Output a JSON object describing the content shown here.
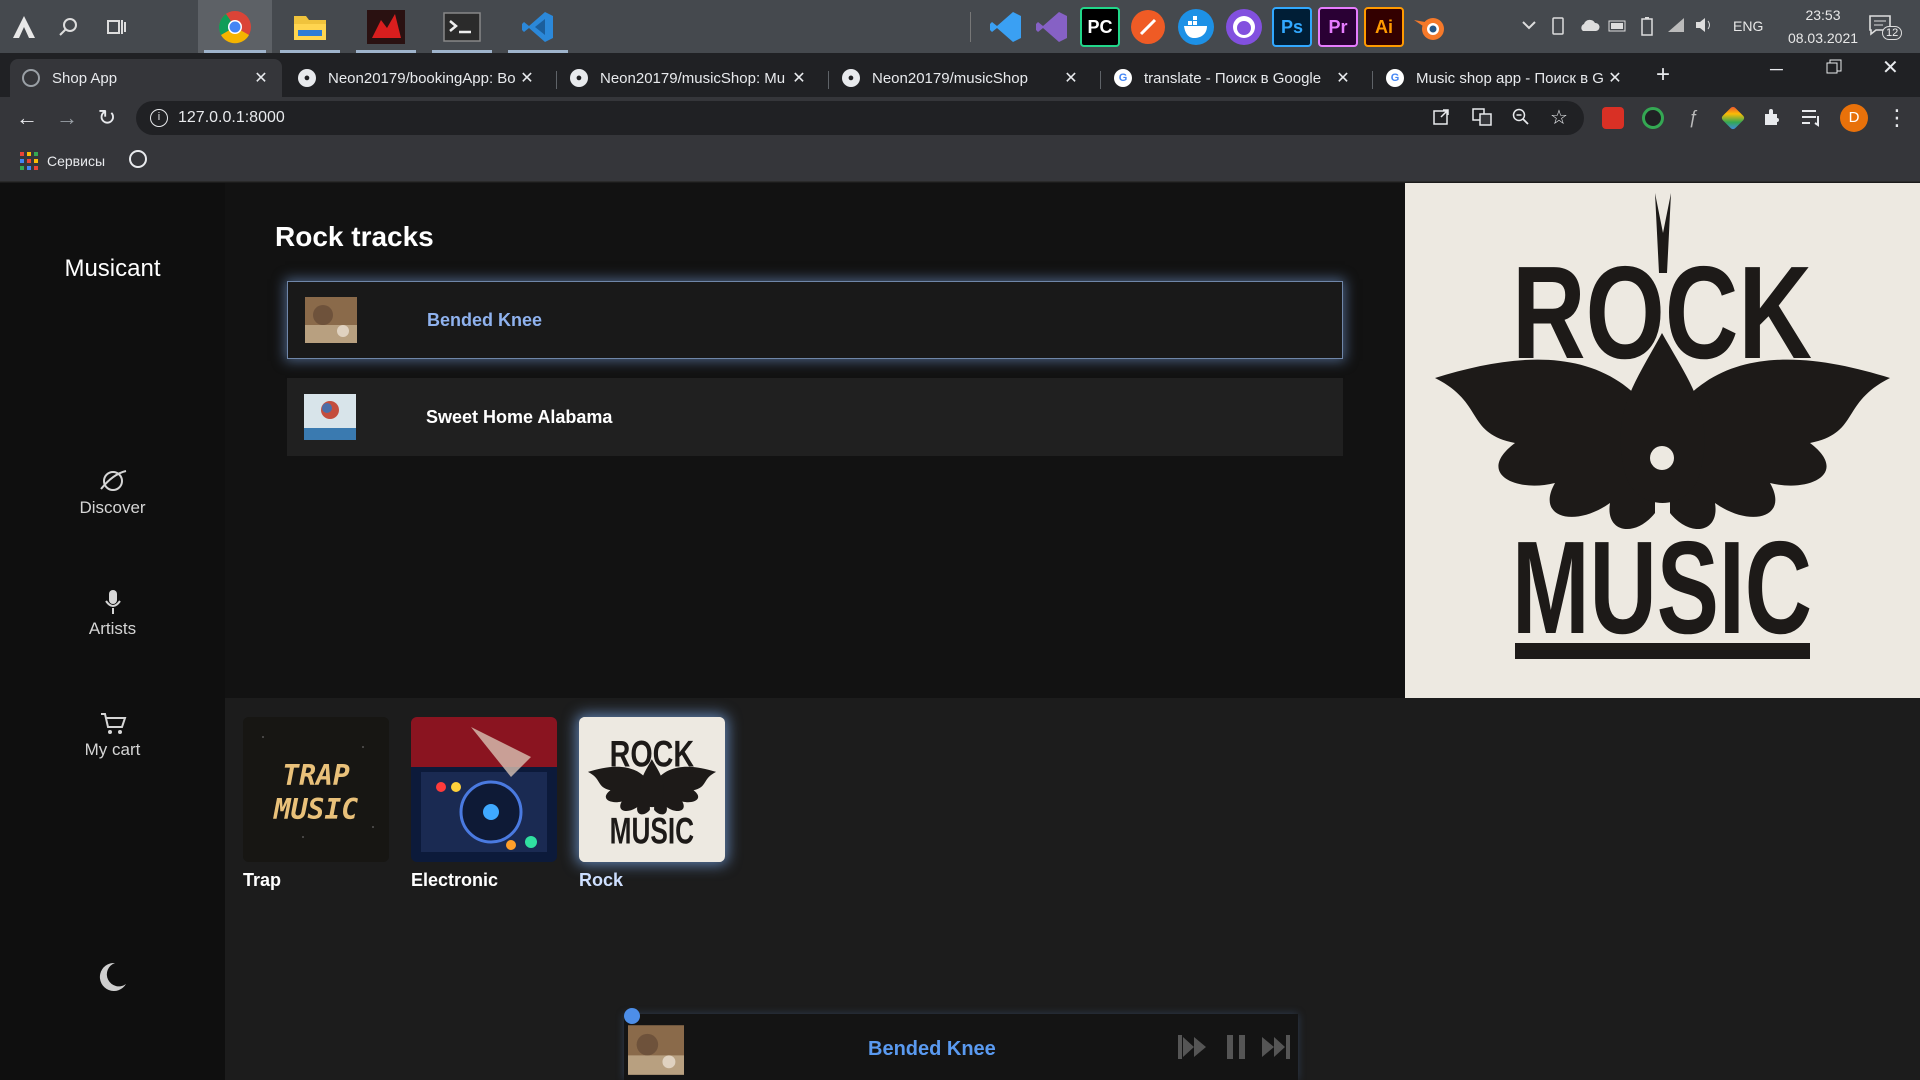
{
  "taskbar": {
    "tray": {
      "lang": "ENG",
      "time": "23:53",
      "date": "08.03.2021",
      "notifications": "12"
    },
    "apps": [
      "arc-icon",
      "search-icon",
      "task-view-icon",
      "chrome-icon",
      "file-explorer-icon",
      "app-red-icon",
      "terminal-icon",
      "vscode-icon"
    ],
    "pinned": [
      "vscode-blue-icon",
      "visual-studio-icon",
      "pycharm-icon",
      "postman-icon",
      "docker-icon",
      "github-desktop-icon",
      "photoshop-icon",
      "premiere-icon",
      "illustrator-icon",
      "blender-icon"
    ],
    "labels": {
      "pycharm": "PC",
      "photoshop": "Ps",
      "premiere": "Pr",
      "illustrator": "Ai"
    }
  },
  "browser": {
    "tabs": [
      {
        "title": "Shop App",
        "active": true
      },
      {
        "title": "Neon20179/bookingApp: Bo"
      },
      {
        "title": "Neon20179/musicShop: Mu"
      },
      {
        "title": "Neon20179/musicShop"
      },
      {
        "title": "translate - Поиск в Google"
      },
      {
        "title": "Music shop app - Поиск в G"
      }
    ],
    "url": "127.0.0.1:8000",
    "bookmarks": {
      "apps_label": "Сервисы"
    },
    "profile_initial": "D",
    "colors": {
      "profile": "#e8710a"
    }
  },
  "app": {
    "brand": "Musicant",
    "nav": [
      {
        "label": "Discover",
        "icon": "planet-icon"
      },
      {
        "label": "Artists",
        "icon": "microphone-icon"
      },
      {
        "label": "My cart",
        "icon": "cart-icon"
      }
    ],
    "section_title": "Rock tracks",
    "tracks": [
      {
        "name": "Bended Knee",
        "playing": true
      },
      {
        "name": "Sweet Home Alabama",
        "playing": false
      }
    ],
    "hero": {
      "line1": "ROCK",
      "line2": "MUSIC"
    },
    "genres": [
      {
        "name": "Trap",
        "art_text": "TRAP MUSIC"
      },
      {
        "name": "Electronic"
      },
      {
        "name": "Rock",
        "selected": true
      }
    ],
    "player": {
      "title": "Bended Knee",
      "state": "playing"
    },
    "colors": {
      "accent": "#5a9af0",
      "sidebar": "#0f0f0f",
      "main": "#121212"
    }
  }
}
